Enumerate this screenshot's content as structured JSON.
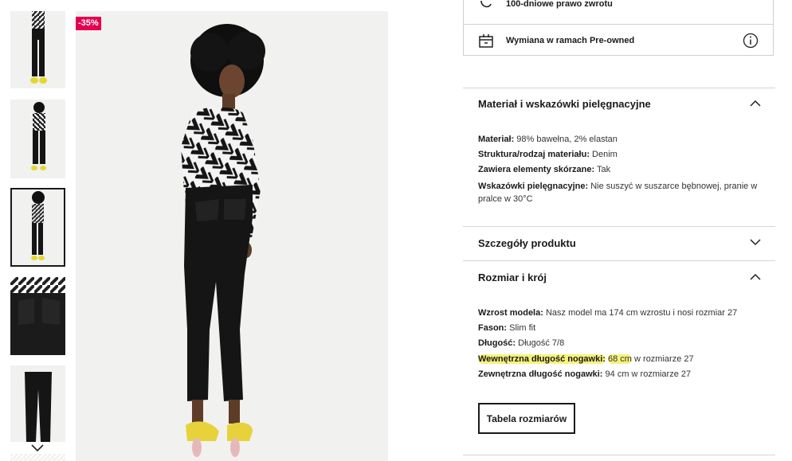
{
  "gallery": {
    "discount_badge": "-35%",
    "thumbnail_count": 5
  },
  "services": {
    "return_label": "100-dniowe prawo zwrotu",
    "preowned_label": "Wymiana w ramach Pre-owned"
  },
  "material_section": {
    "title": "Materiał i wskazówki pielęgnacyjne",
    "expanded": true,
    "rows": [
      {
        "key": "Materiał:",
        "value": " 98% bawełna, 2% elastan"
      },
      {
        "key": "Struktura/rodzaj materiału:",
        "value": " Denim"
      },
      {
        "key": "Zawiera elementy skórzane:",
        "value": " Tak"
      },
      {
        "key": "Wskazówki pielęgnacyjne:",
        "value": " Nie suszyć w suszarce bębnowej, pranie w pralce w 30°C"
      }
    ]
  },
  "details_section": {
    "title": "Szczegóły produktu",
    "expanded": false
  },
  "size_section": {
    "title": "Rozmiar i krój",
    "expanded": true,
    "rows": [
      {
        "key": "Wzrost modela:",
        "value": " Nasz model ma 174 cm wzrostu i nosi rozmiar 27"
      },
      {
        "key": "Fason:",
        "value": " Slim fit"
      },
      {
        "key": "Długość:",
        "value": " Długość 7/8"
      },
      {
        "key": "Wewnętrzna długość nogawki:",
        "value_pre": " ",
        "value_hl": "68 cm",
        "value_post": " w rozmiarze 27"
      },
      {
        "key": "Zewnętrzna długość nogawki:",
        "value": " 94 cm w rozmiarze 27"
      }
    ],
    "size_chart_button": "Tabela rozmiarów"
  },
  "colors": {
    "discount": "#e5004f",
    "highlight": "#f6f27a",
    "border": "#d4d4d4"
  }
}
